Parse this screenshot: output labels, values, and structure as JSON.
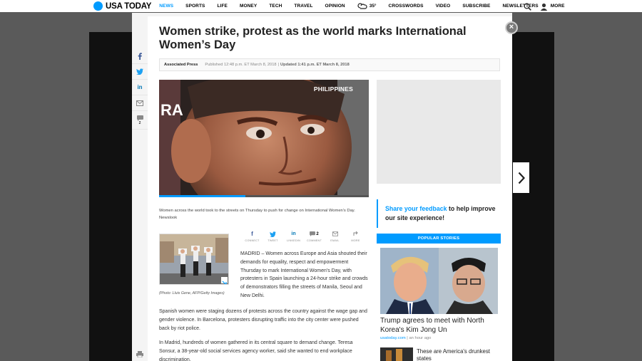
{
  "nav": {
    "logo": "USA TODAY",
    "items": [
      "NEWS",
      "SPORTS",
      "LIFE",
      "MONEY",
      "TECH",
      "TRAVEL",
      "OPINION"
    ],
    "weather": "35°",
    "items_right": [
      "CROSSWORDS",
      "VIDEO",
      "SUBSCRIBE",
      "NEWSLETTERS",
      "MORE"
    ]
  },
  "article": {
    "title": "Women strike, protest as the world marks International Women’s Day",
    "author": "Associated Press",
    "published": "Published 12:48 p.m. ET March 8, 2018",
    "separator": "|",
    "updated": "Updated 1:41 p.m. ET March 8, 2018",
    "hero_label": "PHILIPPINES",
    "hero_progress": 0.41,
    "caption": "Women across the world took to the streets on Thursday to push for change on International Women's Day. Newslook",
    "photo_credit": "(Photo: Lluis Gene, AFP/Getty Images)",
    "paragraphs": [
      "MADRID – Women across Europe and Asia shouted their demands for equality, respect and empowerment Thursday to mark International Women's Day, with protesters in Spain launching a 24-hour strike and crowds of demonstrators filling the streets of Manila, Seoul and New Delhi.",
      "Spanish women were staging dozens of protests across the country against the wage gap and gender violence. In Barcelona, protesters disrupting traffic into the city center were pushed back by riot police.",
      "In Madrid, hundreds of women gathered in its central square to demand change. Teresa Sonsur, a 38-year-old social services agency worker, said she wanted to end workplace discrimination."
    ]
  },
  "rail": {
    "comment_count": "2"
  },
  "share": [
    {
      "icon": "f",
      "label": "CONNECT"
    },
    {
      "icon": "tw",
      "label": "TWEET"
    },
    {
      "icon": "in",
      "label": "LINKEDIN"
    },
    {
      "icon": "cm",
      "count": "2",
      "label": "COMMENT"
    },
    {
      "icon": "em",
      "label": "EMAIL"
    },
    {
      "icon": "mo",
      "label": "MORE"
    }
  ],
  "sidebar": {
    "feedback_link": "Share your feedback",
    "feedback_rest": " to help improve our site experience!",
    "popular_header": "POPULAR STORIES",
    "story1_title": "Trump agrees to meet with North Korea's Kim Jong Un",
    "story1_source": "usatoday.com",
    "story1_sep": "|",
    "story1_time": "an hour ago",
    "story2_title": "These are America's drunkest states"
  },
  "colors": {
    "accent": "#009bff",
    "background": "#5a5a5a",
    "text": "#222222"
  }
}
